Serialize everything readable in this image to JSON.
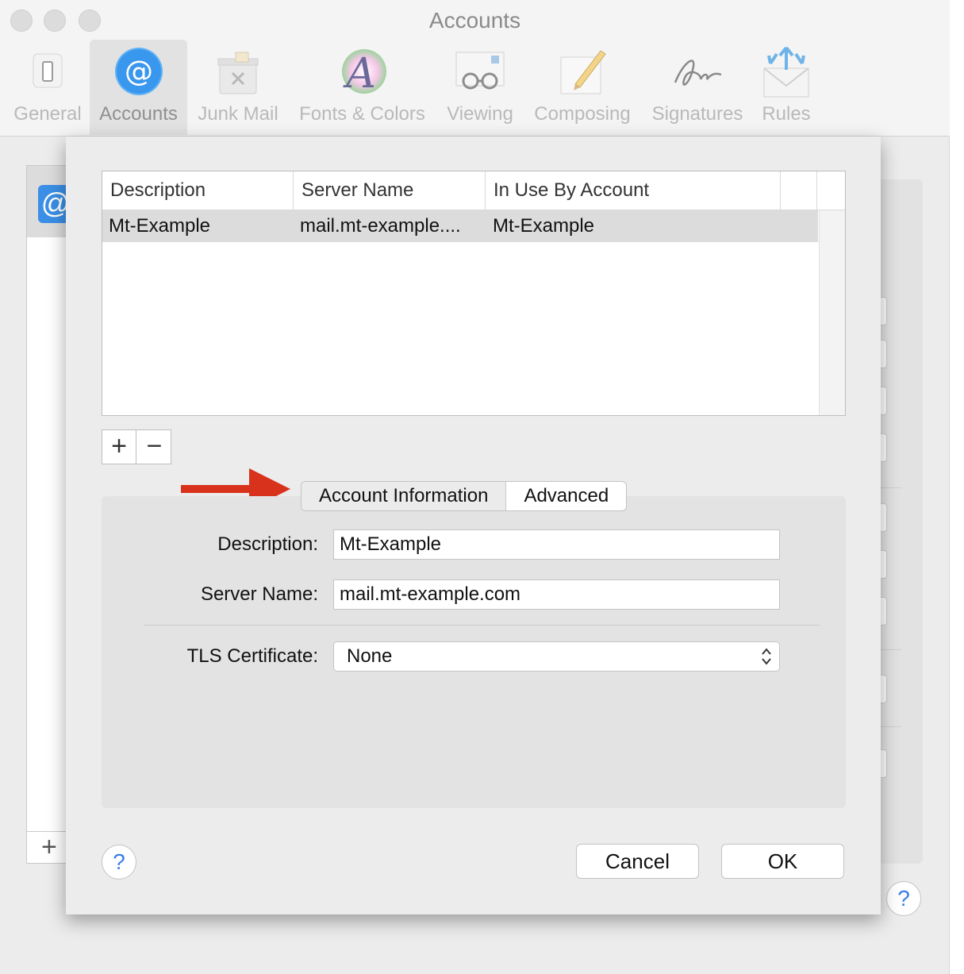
{
  "window": {
    "title": "Accounts"
  },
  "toolbar": {
    "items": [
      {
        "label": "General",
        "icon": "general-switch-icon"
      },
      {
        "label": "Accounts",
        "icon": "at-sign-icon",
        "active": true
      },
      {
        "label": "Junk Mail",
        "icon": "junk-mail-icon"
      },
      {
        "label": "Fonts & Colors",
        "icon": "font-palette-icon"
      },
      {
        "label": "Viewing",
        "icon": "glasses-icon"
      },
      {
        "label": "Composing",
        "icon": "pencil-note-icon"
      },
      {
        "label": "Signatures",
        "icon": "signature-icon"
      },
      {
        "label": "Rules",
        "icon": "rules-envelope-icon"
      }
    ]
  },
  "background": {
    "account_icon": "@",
    "add_label": "+",
    "help_label": "?"
  },
  "smtp_table": {
    "headers": [
      "Description",
      "Server Name",
      "In Use By Account"
    ],
    "rows": [
      {
        "description": "Mt-Example",
        "server_name": "mail.mt-example....",
        "in_use_by": "Mt-Example"
      }
    ],
    "add_label": "+",
    "remove_label": "−"
  },
  "tabs": {
    "items": [
      "Account Information",
      "Advanced"
    ],
    "selected": "Account Information"
  },
  "form": {
    "description_label": "Description:",
    "description_value": "Mt-Example",
    "server_label": "Server Name:",
    "server_value": "mail.mt-example.com",
    "tls_label": "TLS Certificate:",
    "tls_value": "None"
  },
  "footer": {
    "help_label": "?",
    "cancel_label": "Cancel",
    "ok_label": "OK"
  },
  "colors": {
    "annotation_arrow": "#d9321c",
    "accent": "#3b8fe6"
  }
}
